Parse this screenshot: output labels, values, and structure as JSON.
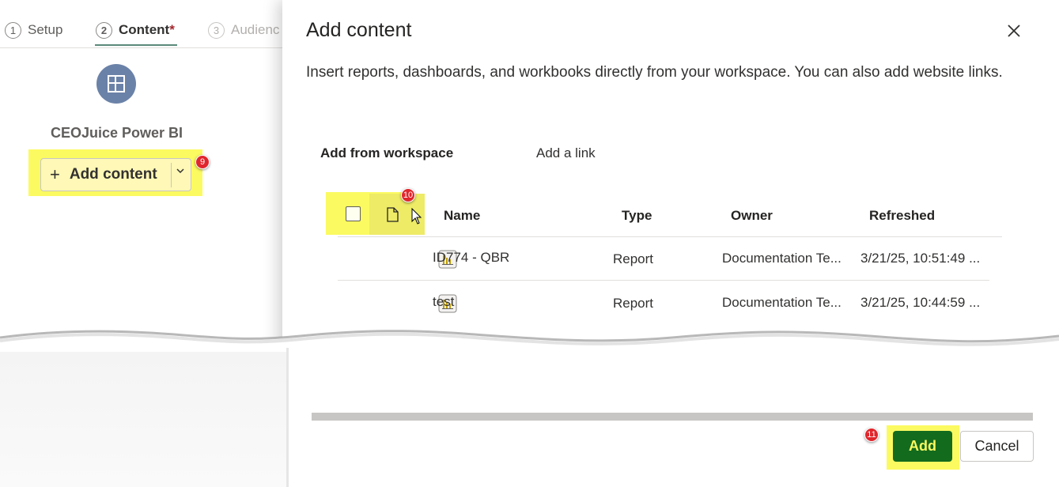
{
  "steps": [
    {
      "num": "1",
      "label": "Setup"
    },
    {
      "num": "2",
      "label": "Content",
      "required": "*"
    },
    {
      "num": "3",
      "label": "Audienc"
    }
  ],
  "app": {
    "name": "CEOJuice Power BI",
    "add_content_label": "Add content",
    "accent_color": "#6b82a8"
  },
  "dialog": {
    "title": "Add content",
    "description": "Insert reports, dashboards, and workbooks directly from your workspace. You can also add website links.",
    "tabs": [
      "Add from workspace",
      "Add a link"
    ],
    "columns": [
      "Name",
      "Type",
      "Owner",
      "Refreshed"
    ],
    "rows": [
      {
        "name": "ID774 - QBR",
        "type": "Report",
        "owner": "Documentation Te...",
        "refreshed": "3/21/25, 10:51:49 ..."
      },
      {
        "name": "test",
        "type": "Report",
        "owner": "Documentation Te...",
        "refreshed": "3/21/25, 10:44:59 ..."
      }
    ],
    "add_label": "Add",
    "cancel_label": "Cancel",
    "primary_color": "#136b1e"
  },
  "markers": [
    "9",
    "10",
    "11"
  ],
  "highlight_color": "#fbfa60"
}
